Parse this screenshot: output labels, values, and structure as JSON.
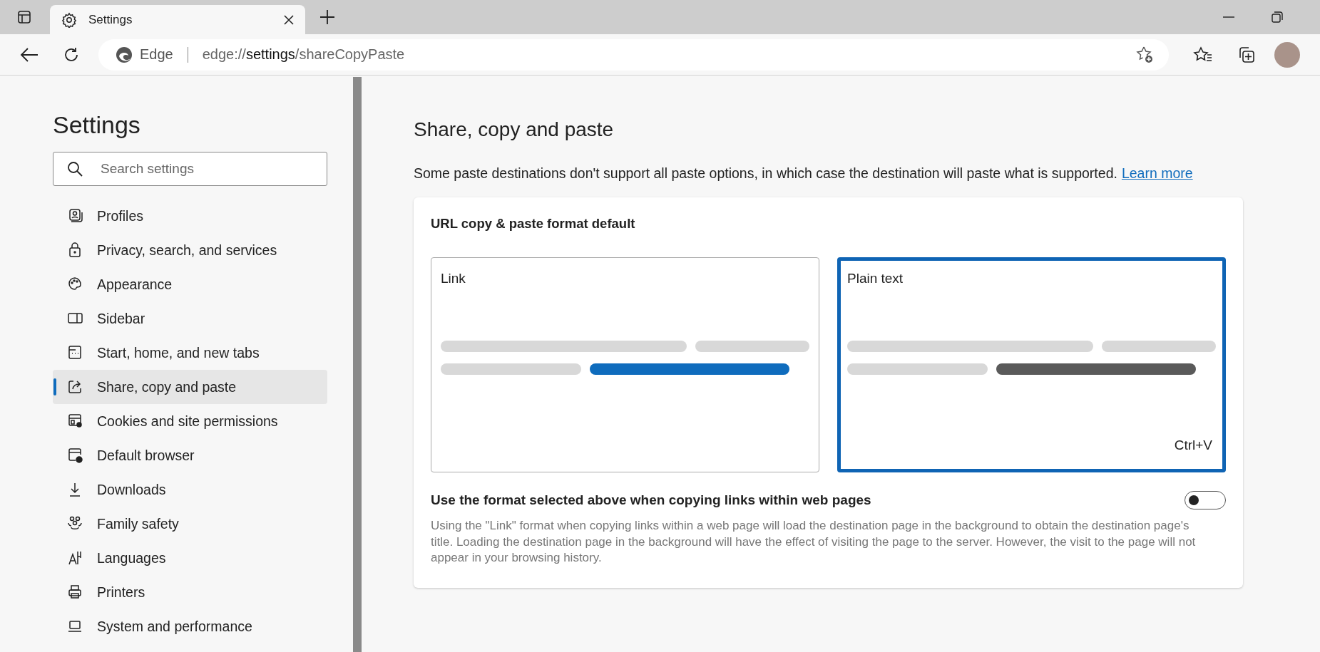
{
  "browser": {
    "tabs": [
      {
        "title": "Settings",
        "selected": true
      }
    ],
    "address_bar": {
      "site_label": "Edge",
      "url": [
        {
          "text": "edge://",
          "emphasized": false
        },
        {
          "text": "settings",
          "emphasized": true
        },
        {
          "text": "/shareCopyPaste",
          "emphasized": false
        }
      ]
    }
  },
  "sidebar": {
    "title": "Settings",
    "search": {
      "placeholder": "Search settings"
    },
    "items": [
      {
        "label": "Profiles",
        "selected": false
      },
      {
        "label": "Privacy, search, and services",
        "selected": false
      },
      {
        "label": "Appearance",
        "selected": false
      },
      {
        "label": "Sidebar",
        "selected": false
      },
      {
        "label": "Start, home, and new tabs",
        "selected": false
      },
      {
        "label": "Share, copy and paste",
        "selected": true
      },
      {
        "label": "Cookies and site permissions",
        "selected": false
      },
      {
        "label": "Default browser",
        "selected": false
      },
      {
        "label": "Downloads",
        "selected": false
      },
      {
        "label": "Family safety",
        "selected": false
      },
      {
        "label": "Languages",
        "selected": false
      },
      {
        "label": "Printers",
        "selected": false
      },
      {
        "label": "System and performance",
        "selected": false
      }
    ]
  },
  "main": {
    "title": "Share, copy and paste",
    "description": "Some paste destinations don't support all paste options, in which case the destination will paste what is supported.",
    "learn_more": "Learn more",
    "card": {
      "title": "URL copy & paste format default",
      "options": [
        {
          "label": "Link",
          "kind": "link",
          "selected": false
        },
        {
          "label": "Plain text",
          "kind": "plain",
          "selected": true,
          "shortcut": "Ctrl+V"
        }
      ],
      "toggle": {
        "label": "Use the format selected above when copying links within web pages",
        "on": false,
        "description": "Using the \"Link\" format when copying links within a web page will load the destination page in the background to obtain the destination page's title. Loading the destination page in the background will have the effect of visiting the page to the server. However, the visit to the page will not appear in your browsing history."
      }
    }
  }
}
